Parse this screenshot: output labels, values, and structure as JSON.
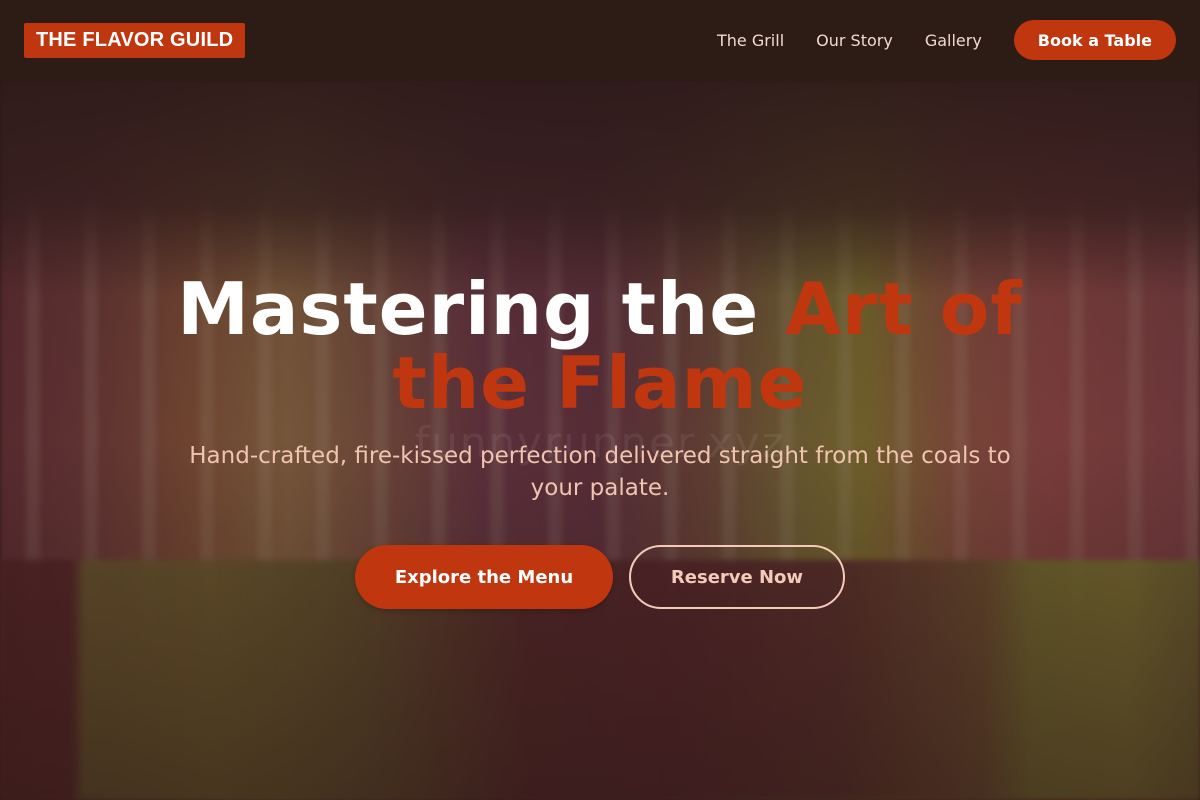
{
  "header": {
    "logo": "THE FLAVOR GUILD",
    "nav": [
      {
        "label": "The Grill"
      },
      {
        "label": "Our Story"
      },
      {
        "label": "Gallery"
      }
    ],
    "cta_label": "Book a Table"
  },
  "hero": {
    "title_main": "Mastering the ",
    "title_accent": "Art of the Flame",
    "subtitle": "Hand-crafted, fire-kissed perfection delivered straight from the coals to your palate.",
    "primary_label": "Explore the Menu",
    "secondary_label": "Reserve Now",
    "watermark": "funnyrunner.xyz",
    "background_image": "blurred rows of colorful popsicles"
  },
  "colors": {
    "accent": "#c0360f",
    "header_bg": "#2d1b16",
    "nav_text": "#f1d9cc",
    "subtitle_text": "#f0c4b0",
    "outline": "#f4cbb8"
  }
}
